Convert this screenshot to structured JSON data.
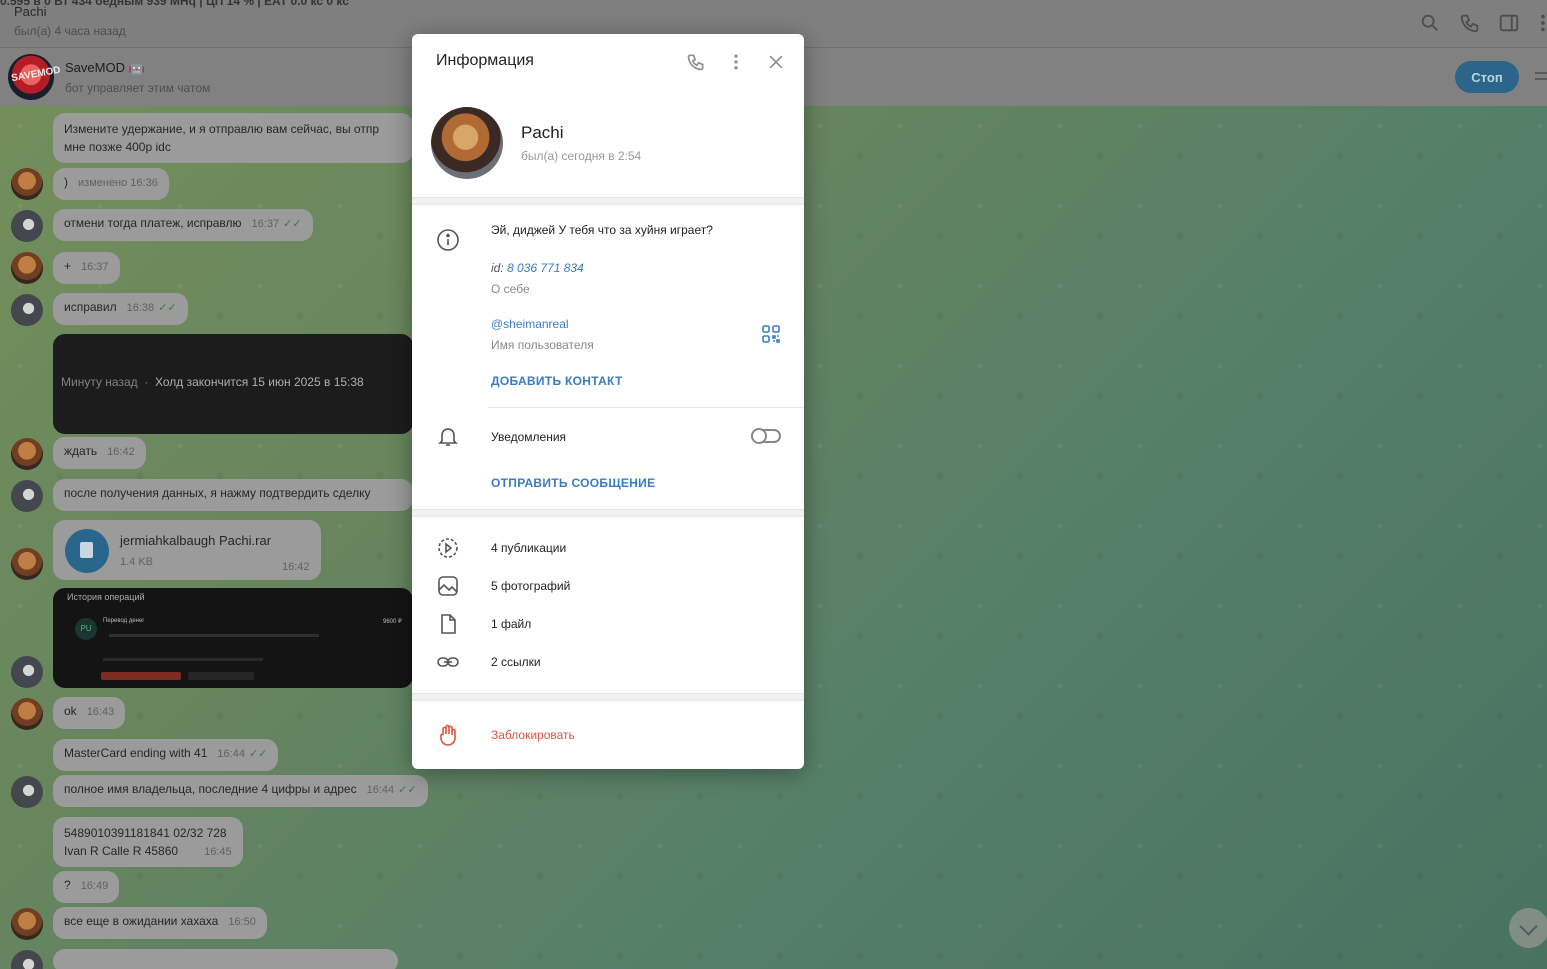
{
  "header": {
    "truncated_top": "0.595 в 0 Вт 434 бедным 939 MHq  |  ЦП 14 %  |  EAT 0.0 кс 0 кс",
    "contact_name": "Pachi",
    "contact_status": "был(а) 4 часа назад"
  },
  "pinned": {
    "bot_name": "SaveMOD 🤖",
    "bot_subtitle": "бот управляет этим чатом",
    "stop_label": "Стоп",
    "avatar_text": "SAVEMOD"
  },
  "messages": [
    {
      "text": "Измените удержание, и я отправлю вам сейчас, вы отпр",
      "text2": "мне позже 400р idc"
    },
    {
      "text": ")",
      "time": "изменено 16:36"
    },
    {
      "text": "отмени тогда платеж, исправлю",
      "time": "16:37"
    },
    {
      "text": "+",
      "time": "16:37"
    },
    {
      "text": "исправил",
      "time": "16:38"
    },
    {
      "text": "ждать",
      "time": "16:42"
    },
    {
      "text": "после получения данных, я нажму подтвердить сделку"
    },
    {
      "text": "ok",
      "time": "16:43"
    },
    {
      "text": "MasterCard ending with 41",
      "time": "16:44"
    },
    {
      "text": "полное имя владельца, последние 4 цифры и адрес",
      "time": "16:44"
    },
    {
      "text": "5489010391181841 02/32 728",
      "text2": "Ivan R Calle R 45860",
      "time": "16:45"
    },
    {
      "text": "?",
      "time": "16:49"
    },
    {
      "text": "все еще в ожидании хахаха",
      "time": "16:50"
    }
  ],
  "dark_card": {
    "ago": "Минуту назад",
    "dot": "·",
    "hold": "Холд закончится 15 июн 2025 в 15:38"
  },
  "op_card": {
    "title": "История операций",
    "transfer": "Перевод денег",
    "amount": "9600 ₽",
    "badge": "PU"
  },
  "file": {
    "name": "jermiahkalbaugh Pachi.rar",
    "size": "1.4 KB",
    "time": "16:42"
  },
  "modal": {
    "title": "Информация",
    "name": "Pachi",
    "seen": "был(а) сегодня в 2:54",
    "bio": "Эй, диджей У тебя что за хуйня играет?",
    "id_prefix": "id:",
    "id_value": "8 036 771 834",
    "about_label": "О себе",
    "username": "@sheimanreal",
    "username_label": "Имя пользователя",
    "add_contact": "ДОБАВИТЬ КОНТАКТ",
    "notifications": "Уведомления",
    "send_message": "ОТПРАВИТЬ СООБЩЕНИЕ",
    "media": [
      "4 публикации",
      "5 фотографий",
      "1 файл",
      "2 ссылки"
    ],
    "block": "Заблокировать"
  },
  "colors": {
    "link": "#3a7cc2",
    "danger": "#e0533d",
    "stop_button": "#2f6e96"
  }
}
